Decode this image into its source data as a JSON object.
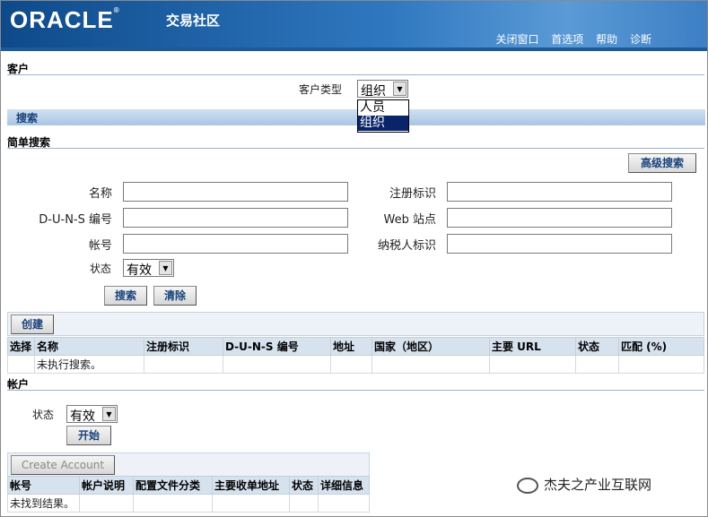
{
  "header": {
    "logo": "ORACLE",
    "app_title": "交易社区",
    "links": [
      "关闭窗口",
      "首选项",
      "帮助",
      "诊断"
    ]
  },
  "customer": {
    "section": "客户",
    "type_label": "客户类型",
    "type_value": "组织",
    "type_options": [
      "人员",
      "组织"
    ]
  },
  "search": {
    "bar_title": "搜索",
    "simple_title": "简单搜索",
    "advanced_button": "高级搜索",
    "fields": {
      "name": "名称",
      "reg_id": "注册标识",
      "duns": "D-U-N-S 编号",
      "web": "Web 站点",
      "account_no": "帐号",
      "taxpayer": "纳税人标识",
      "status": "状态"
    },
    "status_value": "有效",
    "search_button": "搜索",
    "clear_button": "清除"
  },
  "results": {
    "create_button": "创建",
    "columns": [
      "选择",
      "名称",
      "注册标识",
      "D-U-N-S 编号",
      "地址",
      "国家（地区）",
      "主要 URL",
      "状态",
      "匹配 (%)"
    ],
    "empty_text": "未执行搜索。"
  },
  "accounts": {
    "section": "帐户",
    "status_label": "状态",
    "status_value": "有效",
    "go_button": "开始",
    "create_button": "Create Account",
    "columns": [
      "帐号",
      "帐户说明",
      "配置文件分类",
      "主要收单地址",
      "状态",
      "详细信息"
    ],
    "empty_text": "未找到结果。"
  },
  "watermark": "杰夫之产业互联网"
}
